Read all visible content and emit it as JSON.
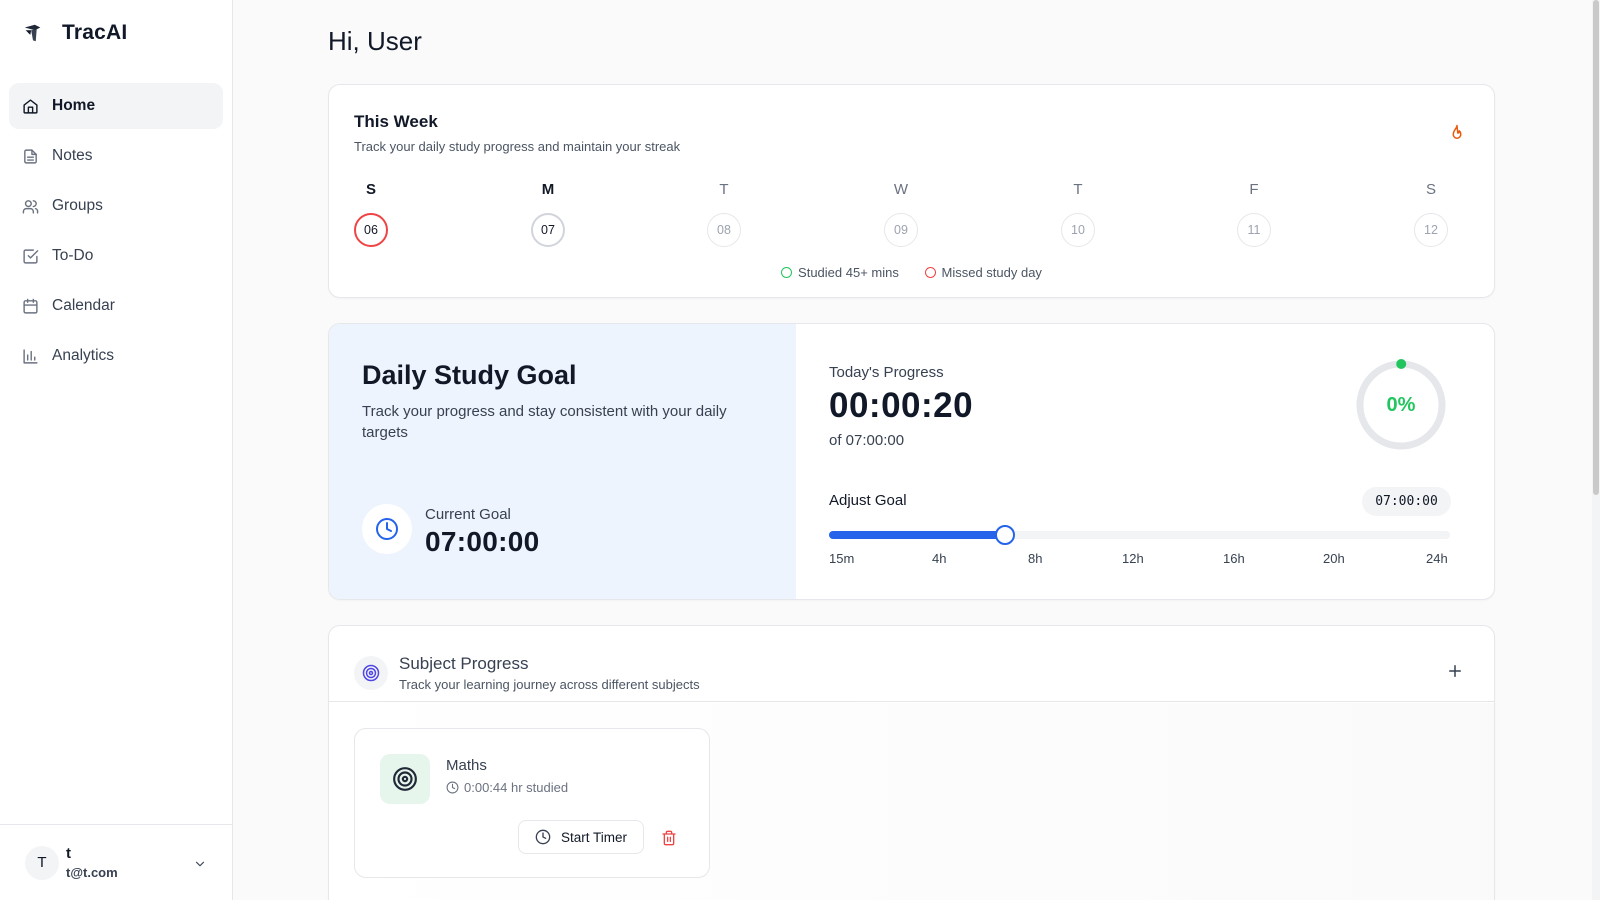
{
  "app": {
    "name": "TracAI"
  },
  "sidebar": {
    "items": [
      {
        "label": "Home",
        "icon": "home-icon",
        "active": true
      },
      {
        "label": "Notes",
        "icon": "notes-icon"
      },
      {
        "label": "Groups",
        "icon": "users-icon"
      },
      {
        "label": "To-Do",
        "icon": "check-square-icon"
      },
      {
        "label": "Calendar",
        "icon": "calendar-icon"
      },
      {
        "label": "Analytics",
        "icon": "bar-chart-icon"
      }
    ],
    "user": {
      "initial": "T",
      "name": "t",
      "email": "t@t.com"
    }
  },
  "main": {
    "greeting": "Hi, User",
    "week": {
      "title": "This Week",
      "subtitle": "Track your daily study progress and maintain your streak",
      "days": [
        {
          "letter": "S",
          "date": "06",
          "status": "missed"
        },
        {
          "letter": "M",
          "date": "07",
          "status": "today"
        },
        {
          "letter": "T",
          "date": "08",
          "status": "future"
        },
        {
          "letter": "W",
          "date": "09",
          "status": "future"
        },
        {
          "letter": "T",
          "date": "10",
          "status": "future"
        },
        {
          "letter": "F",
          "date": "11",
          "status": "future"
        },
        {
          "letter": "S",
          "date": "12",
          "status": "future"
        }
      ],
      "legend": {
        "studied": "Studied 45+ mins",
        "missed": "Missed study day"
      }
    },
    "goal": {
      "title": "Daily Study Goal",
      "description": "Track your progress and stay consistent with your daily targets",
      "current_label": "Current Goal",
      "current_value": "07:00:00",
      "progress_label": "Today's Progress",
      "progress_value": "00:00:20",
      "progress_of": "of 07:00:00",
      "progress_percent_text": "0%",
      "progress_fraction": 0.0008,
      "adjust_label": "Adjust Goal",
      "adjust_value": "07:00:00",
      "slider_value_hours": 7,
      "slider_min_hours": 0.25,
      "slider_max_hours": 24,
      "ticks": [
        "15m",
        "4h",
        "8h",
        "12h",
        "16h",
        "20h",
        "24h"
      ]
    },
    "subjects": {
      "title": "Subject Progress",
      "subtitle": "Track your learning journey across different subjects",
      "items": [
        {
          "name": "Maths",
          "studied": "0:00:44 hr studied",
          "timer_label": "Start Timer"
        }
      ]
    }
  },
  "colors": {
    "accent": "#2563eb",
    "success": "#22c55e",
    "danger": "#ef4444",
    "goal_panel_bg": "#eef4fd"
  }
}
